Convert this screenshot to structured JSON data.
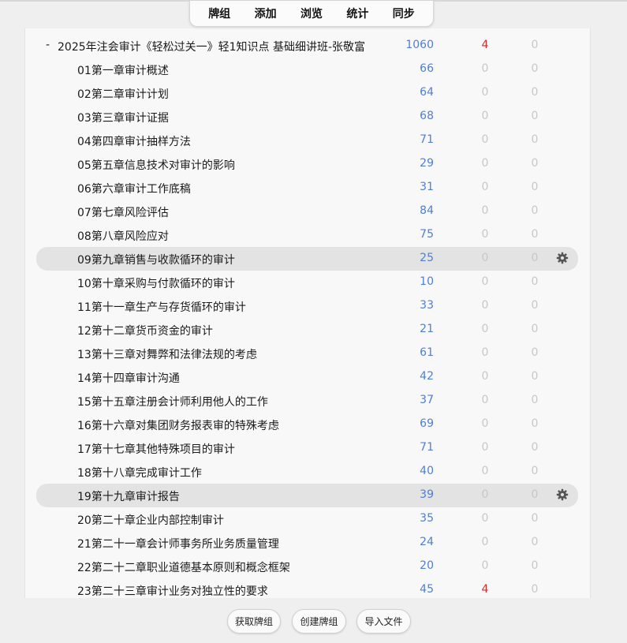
{
  "toolbar": {
    "items": [
      "牌组",
      "添加",
      "浏览",
      "统计",
      "同步"
    ]
  },
  "collapse_symbol": "-",
  "parent_deck": {
    "name": "2025年注会审计《轻松过关一》轻1知识点 基础细讲班-张敬富",
    "new": "1060",
    "learn": "4",
    "due": "0"
  },
  "decks": [
    {
      "name": "01第一章审计概述",
      "new": "66",
      "learn": "0",
      "due": "0"
    },
    {
      "name": "02第二章审计计划",
      "new": "64",
      "learn": "0",
      "due": "0"
    },
    {
      "name": "03第三章审计证据",
      "new": "68",
      "learn": "0",
      "due": "0"
    },
    {
      "name": "04第四章审计抽样方法",
      "new": "71",
      "learn": "0",
      "due": "0"
    },
    {
      "name": "05第五章信息技术对审计的影响",
      "new": "29",
      "learn": "0",
      "due": "0"
    },
    {
      "name": "06第六章审计工作底稿",
      "new": "31",
      "learn": "0",
      "due": "0"
    },
    {
      "name": "07第七章风险评估",
      "new": "84",
      "learn": "0",
      "due": "0"
    },
    {
      "name": "08第八章风险应对",
      "new": "75",
      "learn": "0",
      "due": "0"
    },
    {
      "name": "09第九章销售与收款循环的审计",
      "new": "25",
      "learn": "0",
      "due": "0"
    },
    {
      "name": "10第十章采购与付款循环的审计",
      "new": "10",
      "learn": "0",
      "due": "0"
    },
    {
      "name": "11第十一章生产与存货循环的审计",
      "new": "33",
      "learn": "0",
      "due": "0"
    },
    {
      "name": "12第十二章货币资金的审计",
      "new": "21",
      "learn": "0",
      "due": "0"
    },
    {
      "name": "13第十三章对舞弊和法律法规的考虑",
      "new": "61",
      "learn": "0",
      "due": "0"
    },
    {
      "name": "14第十四章审计沟通",
      "new": "42",
      "learn": "0",
      "due": "0"
    },
    {
      "name": "15第十五章注册会计师利用他人的工作",
      "new": "37",
      "learn": "0",
      "due": "0"
    },
    {
      "name": "16第十六章对集团财务报表审的特殊考虑",
      "new": "69",
      "learn": "0",
      "due": "0"
    },
    {
      "name": "17第十七章其他特殊项目的审计",
      "new": "71",
      "learn": "0",
      "due": "0"
    },
    {
      "name": "18第十八章完成审计工作",
      "new": "40",
      "learn": "0",
      "due": "0"
    },
    {
      "name": "19第十九章审计报告",
      "new": "39",
      "learn": "0",
      "due": "0"
    },
    {
      "name": "20第二十章企业内部控制审计",
      "new": "35",
      "learn": "0",
      "due": "0"
    },
    {
      "name": "21第二十一章会计师事务所业务质量管理",
      "new": "24",
      "learn": "0",
      "due": "0"
    },
    {
      "name": "22第二十二章职业道德基本原则和概念框架",
      "new": "20",
      "learn": "0",
      "due": "0"
    },
    {
      "name": "23第二十三章审计业务对独立性的要求",
      "new": "45",
      "learn": "4",
      "due": "0"
    }
  ],
  "highlighted_rows": [
    8,
    18
  ],
  "colors": {
    "new": "#4f7ed6",
    "learn_nonzero": "#d12b2b",
    "zero": "#c7c7c7"
  },
  "icons": {
    "row_options": "gear-icon"
  },
  "bottom_buttons": {
    "get_shared": "获取牌组",
    "create_deck": "创建牌组",
    "import_file": "导入文件"
  }
}
